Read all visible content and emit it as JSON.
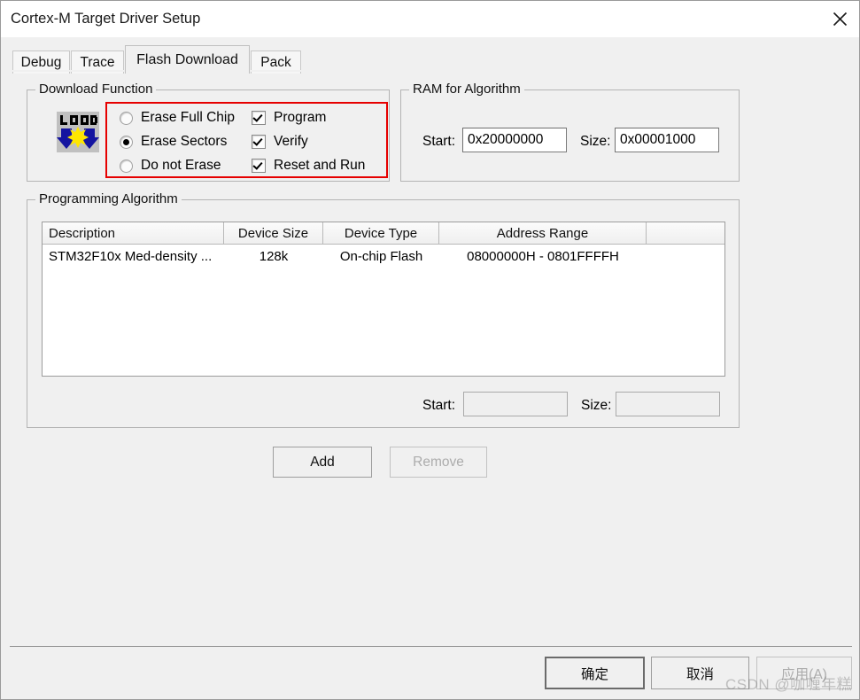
{
  "window": {
    "title": "Cortex-M Target Driver Setup",
    "close_icon": "close-icon"
  },
  "tabs": [
    {
      "label": "Debug",
      "active": false
    },
    {
      "label": "Trace",
      "active": false
    },
    {
      "label": "Flash Download",
      "active": true
    },
    {
      "label": "Pack",
      "active": false
    }
  ],
  "download_function": {
    "group_title": "Download Function",
    "icon_label": "LOAD",
    "highlight_color": "#e60000",
    "radios": [
      {
        "label": "Erase Full Chip",
        "checked": false
      },
      {
        "label": "Erase Sectors",
        "checked": true
      },
      {
        "label": "Do not Erase",
        "checked": false
      }
    ],
    "checkboxes": [
      {
        "label": "Program",
        "checked": true
      },
      {
        "label": "Verify",
        "checked": true
      },
      {
        "label": "Reset and Run",
        "checked": true
      }
    ]
  },
  "ram_for_algorithm": {
    "group_title": "RAM for Algorithm",
    "start_label": "Start:",
    "start_value": "0x20000000",
    "size_label": "Size:",
    "size_value": "0x00001000"
  },
  "programming_algorithm": {
    "group_title": "Programming Algorithm",
    "columns": [
      "Description",
      "Device Size",
      "Device Type",
      "Address Range",
      ""
    ],
    "rows": [
      {
        "description": "STM32F10x Med-density ...",
        "device_size": "128k",
        "device_type": "On-chip Flash",
        "address_range": "08000000H - 0801FFFFH"
      }
    ],
    "start_label": "Start:",
    "start_value": "",
    "size_label": "Size:",
    "size_value": "",
    "add_label": "Add",
    "remove_label": "Remove"
  },
  "footer": {
    "ok_label": "确定",
    "cancel_label": "取消",
    "apply_label": "应用(A)",
    "watermark": "CSDN @咖喱年糕"
  }
}
